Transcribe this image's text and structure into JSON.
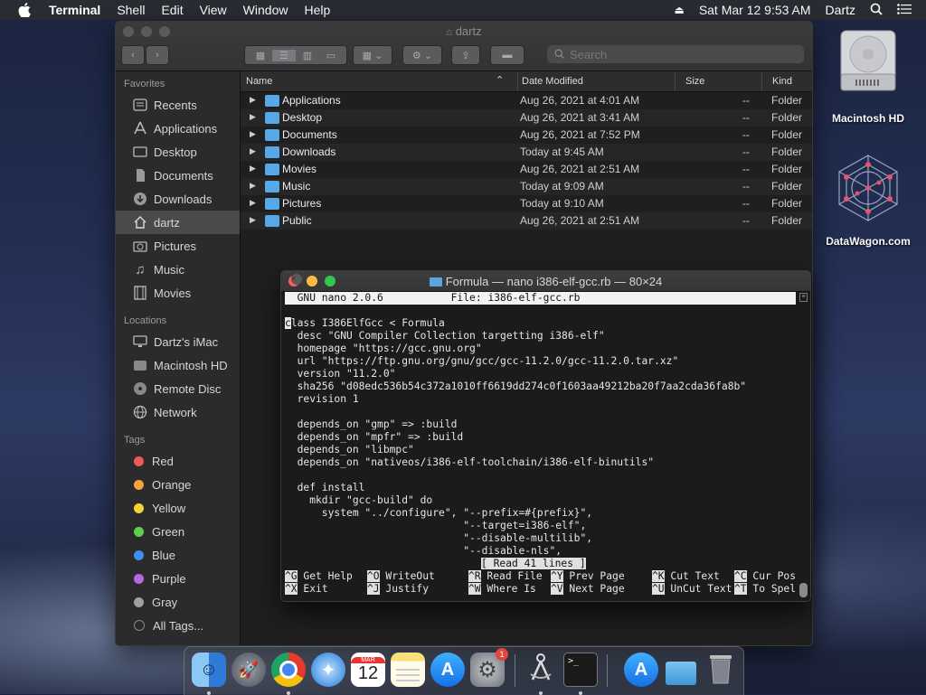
{
  "menubar": {
    "app_name": "Terminal",
    "menus": [
      "Shell",
      "Edit",
      "View",
      "Window",
      "Help"
    ],
    "clock": "Sat Mar 12  9:53 AM",
    "user": "Dartz"
  },
  "finder": {
    "title": "dartz",
    "search_placeholder": "Search",
    "sidebar": {
      "favorites_label": "Favorites",
      "favorites": [
        {
          "label": "Recents",
          "icon": "clock-icon"
        },
        {
          "label": "Applications",
          "icon": "applications-icon"
        },
        {
          "label": "Desktop",
          "icon": "desktop-icon"
        },
        {
          "label": "Documents",
          "icon": "document-icon"
        },
        {
          "label": "Downloads",
          "icon": "download-icon"
        },
        {
          "label": "dartz",
          "icon": "home-icon"
        },
        {
          "label": "Pictures",
          "icon": "camera-icon"
        },
        {
          "label": "Music",
          "icon": "music-icon"
        },
        {
          "label": "Movies",
          "icon": "film-icon"
        }
      ],
      "locations_label": "Locations",
      "locations": [
        {
          "label": "Dartz's iMac",
          "icon": "imac-icon"
        },
        {
          "label": "Macintosh HD",
          "icon": "disk-icon"
        },
        {
          "label": "Remote Disc",
          "icon": "disc-icon"
        },
        {
          "label": "Network",
          "icon": "globe-icon"
        }
      ],
      "tags_label": "Tags",
      "tags": [
        {
          "label": "Red",
          "color": "#ec5b57"
        },
        {
          "label": "Orange",
          "color": "#f5a33a"
        },
        {
          "label": "Yellow",
          "color": "#f6d132"
        },
        {
          "label": "Green",
          "color": "#5fcf4f"
        },
        {
          "label": "Blue",
          "color": "#3f8ef2"
        },
        {
          "label": "Purple",
          "color": "#b868df"
        },
        {
          "label": "Gray",
          "color": "#a0a0a0"
        }
      ],
      "all_tags": "All Tags..."
    },
    "columns": {
      "name": "Name",
      "date": "Date Modified",
      "size": "Size",
      "kind": "Kind"
    },
    "rows": [
      {
        "name": "Applications",
        "date": "Aug 26, 2021 at 4:01 AM",
        "size": "--",
        "kind": "Folder"
      },
      {
        "name": "Desktop",
        "date": "Aug 26, 2021 at 3:41 AM",
        "size": "--",
        "kind": "Folder"
      },
      {
        "name": "Documents",
        "date": "Aug 26, 2021 at 7:52 PM",
        "size": "--",
        "kind": "Folder"
      },
      {
        "name": "Downloads",
        "date": "Today at 9:45 AM",
        "size": "--",
        "kind": "Folder"
      },
      {
        "name": "Movies",
        "date": "Aug 26, 2021 at 2:51 AM",
        "size": "--",
        "kind": "Folder"
      },
      {
        "name": "Music",
        "date": "Today at 9:09 AM",
        "size": "--",
        "kind": "Folder"
      },
      {
        "name": "Pictures",
        "date": "Today at 9:10 AM",
        "size": "--",
        "kind": "Folder"
      },
      {
        "name": "Public",
        "date": "Aug 26, 2021 at 2:51 AM",
        "size": "--",
        "kind": "Folder"
      }
    ]
  },
  "terminal": {
    "title": "Formula — nano i386-elf-gcc.rb — 80×24",
    "nano_header": "  GNU nano 2.0.6           File: i386-elf-gcc.rb                                  ",
    "first_char": "c",
    "lines": [
      "",
      "lass I386ElfGcc < Formula",
      "  desc \"GNU Compiler Collection targetting i386-elf\"",
      "  homepage \"https://gcc.gnu.org\"",
      "  url \"https://ftp.gnu.org/gnu/gcc/gcc-11.2.0/gcc-11.2.0.tar.xz\"",
      "  version \"11.2.0\"",
      "  sha256 \"d08edc536b54c372a1010ff6619dd274c0f1603aa49212ba20f7aa2cda36fa8b\"",
      "  revision 1",
      "",
      "  depends_on \"gmp\" => :build",
      "  depends_on \"mpfr\" => :build",
      "  depends_on \"libmpc\"",
      "  depends_on \"nativeos/i386-elf-toolchain/i386-elf-binutils\"",
      "",
      "  def install",
      "    mkdir \"gcc-build\" do",
      "      system \"../configure\", \"--prefix=#{prefix}\",",
      "                             \"--target=i386-elf\",",
      "                             \"--disable-multilib\",",
      "                             \"--disable-nls\","
    ],
    "status_msg": "[ Read 41 lines ]",
    "shortcuts_row1": [
      {
        "key": "^G",
        "label": "Get Help"
      },
      {
        "key": "^O",
        "label": "WriteOut"
      },
      {
        "key": "^R",
        "label": "Read File"
      },
      {
        "key": "^Y",
        "label": "Prev Page"
      },
      {
        "key": "^K",
        "label": "Cut Text"
      },
      {
        "key": "^C",
        "label": "Cur Pos"
      }
    ],
    "shortcuts_row2": [
      {
        "key": "^X",
        "label": "Exit"
      },
      {
        "key": "^J",
        "label": "Justify"
      },
      {
        "key": "^W",
        "label": "Where Is"
      },
      {
        "key": "^V",
        "label": "Next Page"
      },
      {
        "key": "^U",
        "label": "UnCut Text"
      },
      {
        "key": "^T",
        "label": "To Spell"
      }
    ]
  },
  "desktop": {
    "icons": [
      {
        "label": "Macintosh HD",
        "icon": "hard-drive-icon"
      },
      {
        "label": "DataWagon.com",
        "icon": "datawagon-logo-icon"
      }
    ]
  },
  "dock": {
    "apps": [
      "finder",
      "launchpad",
      "chrome",
      "safari",
      "calendar",
      "notes",
      "app-store",
      "system-preferences",
      "instruments",
      "terminal",
      "app-store-2",
      "downloads-folder",
      "trash"
    ],
    "calendar_month": "MAR",
    "calendar_day": "12",
    "prefs_badge": "1"
  }
}
